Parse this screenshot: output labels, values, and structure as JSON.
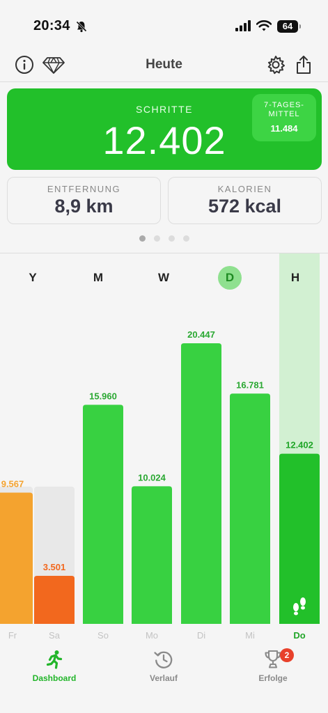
{
  "status_bar": {
    "time": "20:34",
    "battery": "64"
  },
  "header": {
    "title": "Heute"
  },
  "steps_card": {
    "label": "SCHRITTE",
    "value": "12.402",
    "avg_label": "7-TAGES-MITTEL",
    "avg_value": "11.484"
  },
  "distance": {
    "label": "ENTFERNUNG",
    "value": "8,9 km"
  },
  "calories": {
    "label": "KALORIEN",
    "value": "572 kcal"
  },
  "range_tabs": [
    {
      "label": "Y",
      "active": false
    },
    {
      "label": "M",
      "active": false
    },
    {
      "label": "W",
      "active": false
    },
    {
      "label": "D",
      "active": true
    },
    {
      "label": "H",
      "active": false
    }
  ],
  "chart_data": {
    "type": "bar",
    "categories": [
      "Fr",
      "Sa",
      "So",
      "Mo",
      "Di",
      "Mi",
      "Do"
    ],
    "values": [
      9567,
      3501,
      15960,
      10024,
      20447,
      16781,
      12402
    ],
    "value_labels": [
      "9.567",
      "3.501",
      "15.960",
      "10.024",
      "20.447",
      "16.781",
      "12.402"
    ],
    "goal": 10000,
    "selected": "Do",
    "colors": {
      "goal_met": "#38d141",
      "today": "#22c02a",
      "below_goal_high": "#f4a32f",
      "below_goal_low": "#f2681e",
      "track": "#e8e8e8",
      "selected_bg": "#d2f0d2"
    }
  },
  "tab_bar": {
    "items": [
      {
        "label": "Dashboard",
        "icon": "running-person-icon",
        "active": true
      },
      {
        "label": "Verlauf",
        "icon": "history-clock-icon",
        "active": false
      },
      {
        "label": "Erfolge",
        "icon": "trophy-icon",
        "active": false,
        "badge": "2"
      }
    ]
  },
  "colors": {
    "accent": "#22c02a",
    "background": "#f5f5f5"
  }
}
